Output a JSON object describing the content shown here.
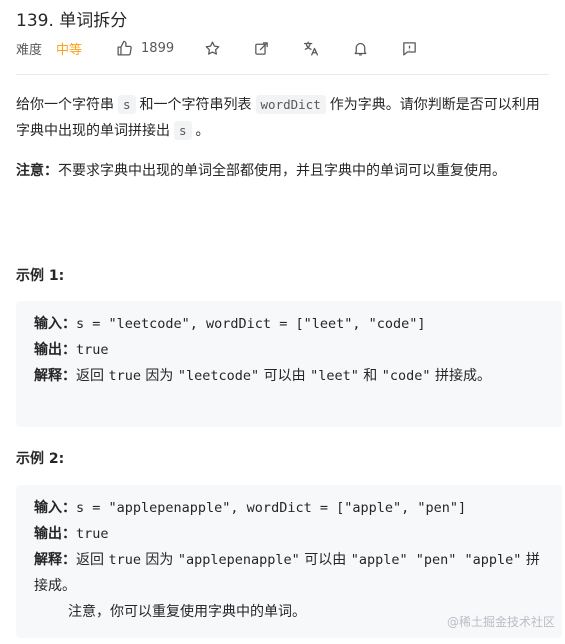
{
  "problem": {
    "title": "139. 单词拆分",
    "difficulty_label": "难度",
    "difficulty_value": "中等",
    "likes": "1899"
  },
  "icons": [
    "thumbs-up-icon",
    "star-icon",
    "share-icon",
    "translate-icon",
    "bell-icon",
    "feedback-icon"
  ],
  "colors": {
    "difficulty": "#ffa116",
    "code_bg": "#f2f3f5",
    "example_bg": "#f7f8fa"
  },
  "description": {
    "p1_a": "给你一个字符串",
    "p1_code_s": "s",
    "p1_b": "和一个字符串列表",
    "p1_code_dict": "wordDict",
    "p1_c": "作为字典。请你判断是否可以利用字典中出现的单词拼接出",
    "p1_code_s2": "s",
    "p1_d": "。",
    "note_label": "注意：",
    "note_text": "不要求字典中出现的单词全部都使用，并且字典中的单词可以重复使用。"
  },
  "examples": [
    {
      "title": "示例 1:",
      "input_label": "输入：",
      "input": "s = \"leetcode\", wordDict = [\"leet\", \"code\"]",
      "output_label": "输出：",
      "output": "true",
      "explain_label": "解释：",
      "explain_a": "返回",
      "explain_true": "true",
      "explain_b": "因为",
      "explain_c": "\"leetcode\"",
      "explain_d": "可以由",
      "explain_e": "\"leet\"",
      "explain_f": "和",
      "explain_g": "\"code\"",
      "explain_h": "拼接成。"
    },
    {
      "title": "示例 2:",
      "input_label": "输入：",
      "input": "s = \"applepenapple\", wordDict = [\"apple\", \"pen\"]",
      "output_label": "输出：",
      "output": "true",
      "explain_label": "解释：",
      "explain_a": "返回",
      "explain_true": "true",
      "explain_b": "因为",
      "explain_c": "\"applepenapple\"",
      "explain_d": "可以由",
      "explain_e": "\"apple\" \"pen\" \"apple\"",
      "explain_h": "拼接成。",
      "note": "注意，你可以重复使用字典中的单词。"
    }
  ],
  "watermark": "@稀土掘金技术社区"
}
